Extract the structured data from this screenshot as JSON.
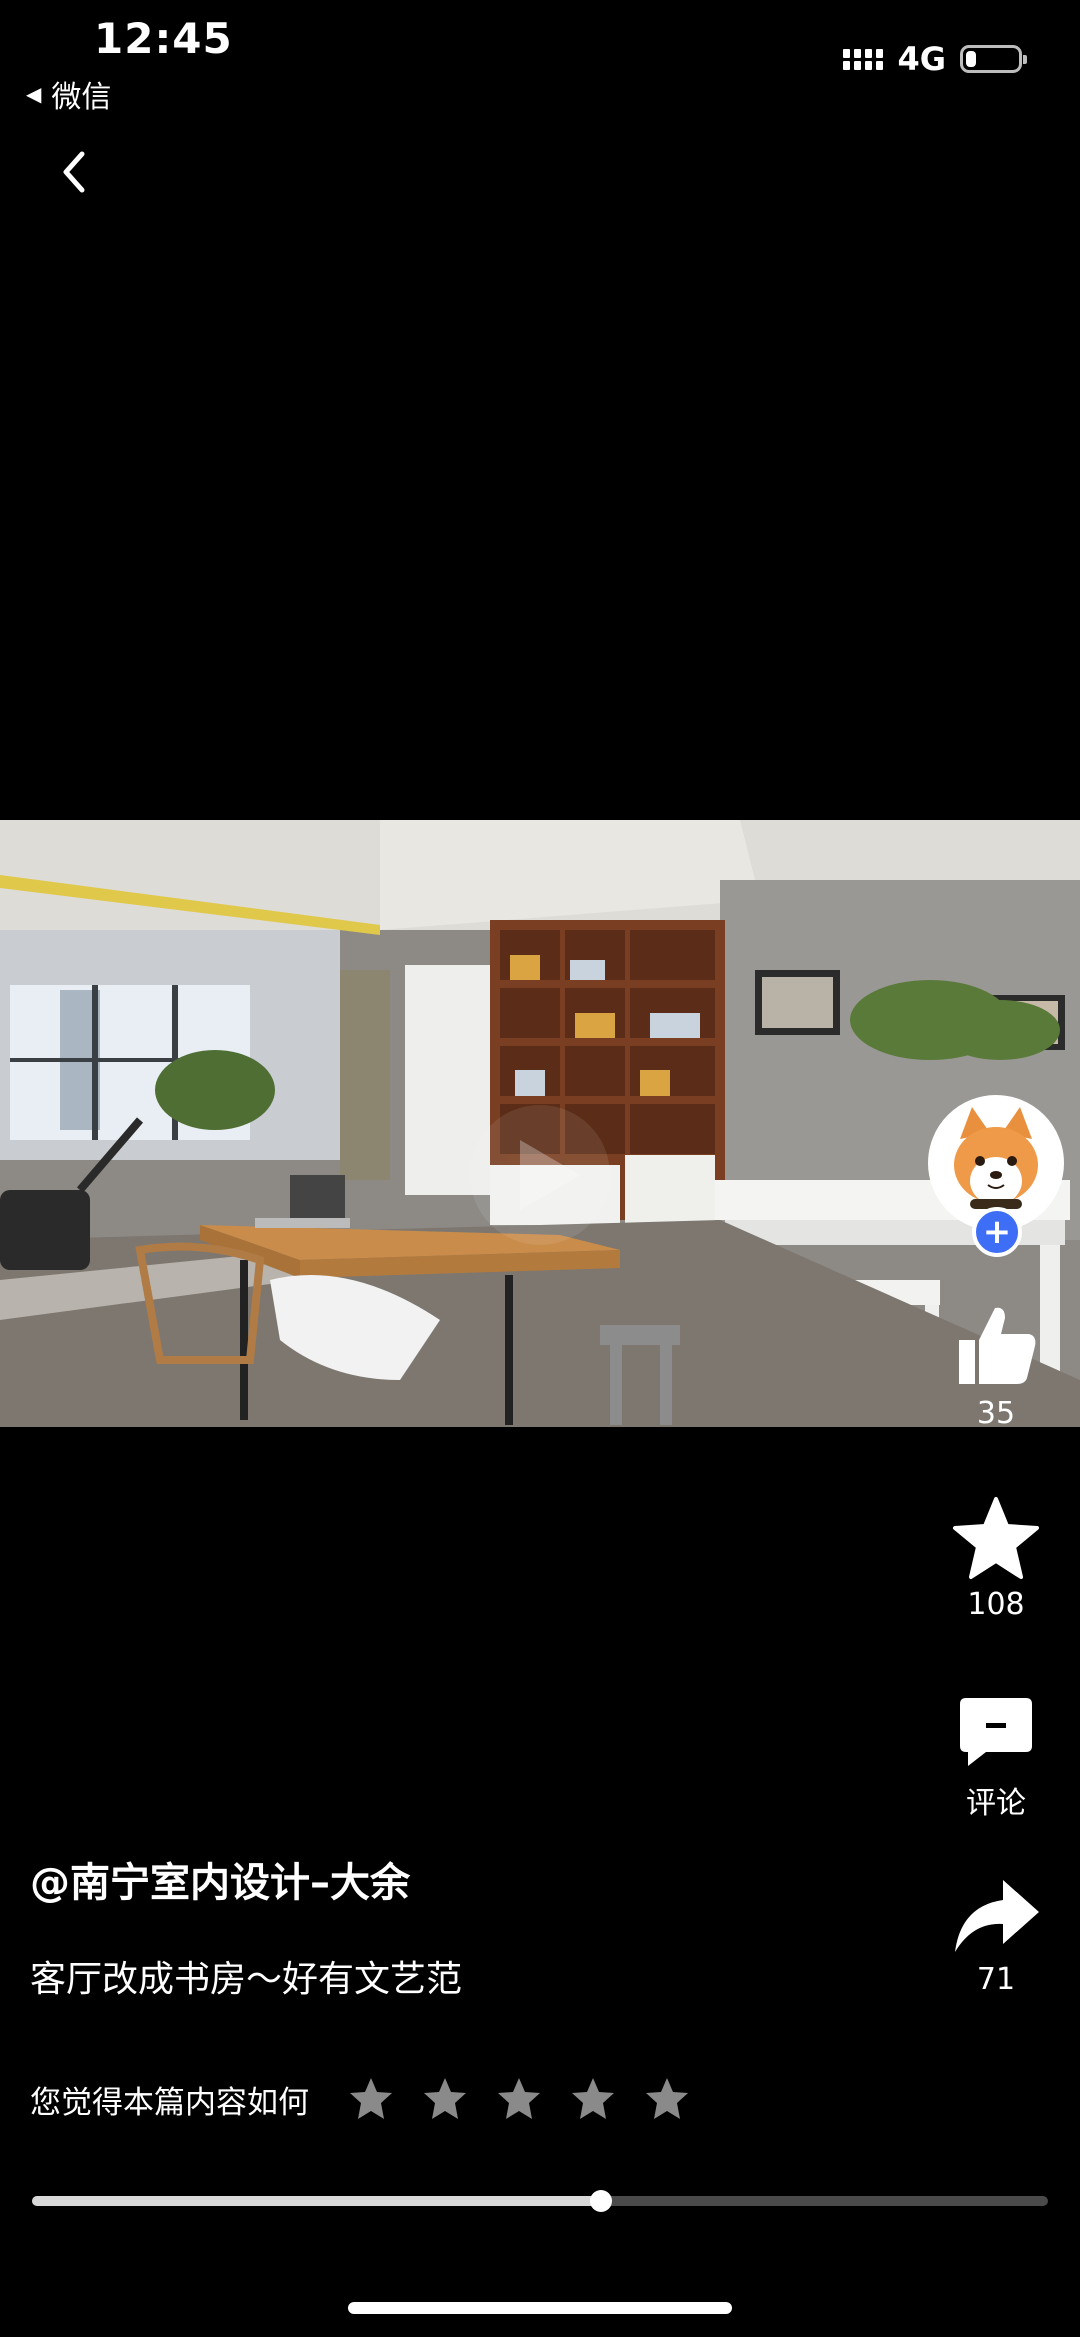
{
  "status_bar": {
    "time": "12:45",
    "back_app": "微信",
    "network": "4G",
    "battery_level": 0.2
  },
  "video": {
    "play_icon": "play-icon"
  },
  "author": {
    "handle": "@南宁室内设计–大余"
  },
  "post": {
    "title": "客厅改成书房～好有文艺范"
  },
  "actions": {
    "like_count": "35",
    "favorite_count": "108",
    "comment_label": "评论",
    "share_count": "71"
  },
  "rating": {
    "prompt": "您觉得本篇内容如何",
    "stars_total": 5,
    "stars_selected": 0
  },
  "progress": {
    "fraction": 0.56
  },
  "colors": {
    "follow_button": "#3d6ef5",
    "background": "#000000",
    "star_inactive": "#8a8a8a"
  }
}
